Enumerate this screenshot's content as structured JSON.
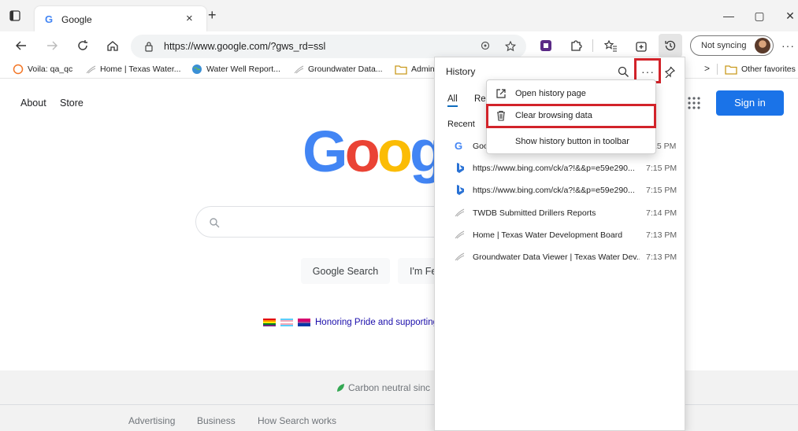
{
  "tab": {
    "title": "Google",
    "close": "×",
    "new": "+"
  },
  "window": {
    "minimize": "—",
    "maximize": "▢",
    "close": "✕"
  },
  "address": {
    "url": "https://www.google.com/?gws_rd=ssl"
  },
  "profile": {
    "sync_label": "Not syncing"
  },
  "favorites": {
    "items": [
      "Voila: qa_qc",
      "Home | Texas Water...",
      "Water Well Report...",
      "Groundwater Data...",
      "Admin"
    ],
    "other": "Other favorites",
    "more": ">"
  },
  "google": {
    "about": "About",
    "store": "Store",
    "sign_in": "Sign in",
    "logo": "Goog",
    "search_button": "Google Search",
    "lucky_button": "I'm Fe",
    "pride_text": "Honoring Pride and supporting",
    "carbon": "Carbon neutral sinc",
    "footer": [
      "Advertising",
      "Business",
      "How Search works"
    ]
  },
  "history": {
    "title": "History",
    "tabs": [
      "All",
      "Rec"
    ],
    "section": "Recent",
    "rows": [
      {
        "icon": "google-favicon",
        "title": "Goo",
        "time": "15 PM"
      },
      {
        "icon": "bing-favicon",
        "title": "https://www.bing.com/ck/a?!&&p=e59e290...",
        "time": "7:15 PM"
      },
      {
        "icon": "bing-favicon",
        "title": "https://www.bing.com/ck/a?!&&p=e59e290...",
        "time": "7:15 PM"
      },
      {
        "icon": "twdb-favicon",
        "title": "TWDB Submitted Drillers Reports",
        "time": "7:14 PM"
      },
      {
        "icon": "twdb-favicon",
        "title": "Home | Texas Water Development Board",
        "time": "7:13 PM"
      },
      {
        "icon": "twdb-favicon",
        "title": "Groundwater Data Viewer | Texas Water Dev...",
        "time": "7:13 PM"
      }
    ],
    "more_label": "···"
  },
  "menu": {
    "items": [
      "Open history page",
      "Clear browsing data",
      "Show history button in toolbar"
    ]
  },
  "colors": {
    "highlight": "#d2232a",
    "accent": "#1a73e8"
  }
}
